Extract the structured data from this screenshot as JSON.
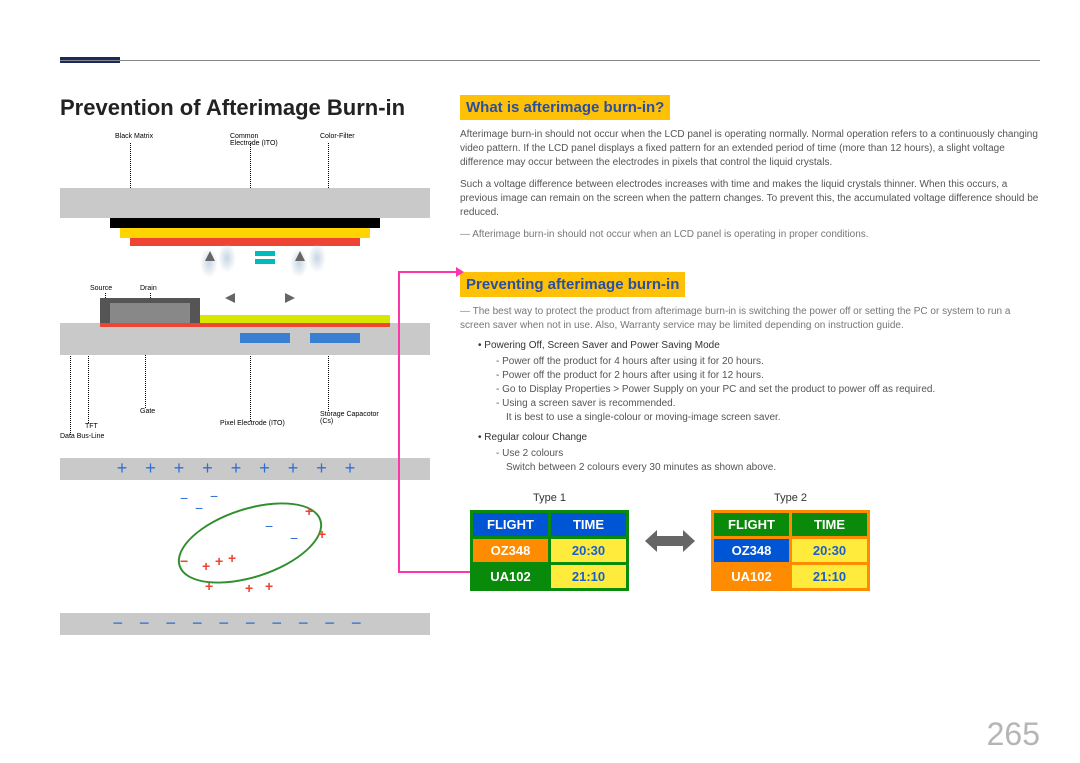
{
  "page_title": "Prevention of Afterimage Burn-in",
  "diagram_labels": {
    "black_matrix": "Black Matrix",
    "common_electrode": "Common Electrode (ITO)",
    "color_filter": "Color-Filter",
    "source": "Source",
    "drain": "Drain",
    "gate": "Gate",
    "tft": "TFT",
    "data_bus": "Data Bus-Line",
    "pixel_electrode": "Pixel Electrode (ITO)",
    "storage_cap": "Storage Capacotor (Cs)"
  },
  "section1": {
    "heading": "What is afterimage burn-in?",
    "p1": "Afterimage burn-in should not occur when the LCD panel is operating normally. Normal operation refers to a continuously changing video pattern. If the LCD panel displays a fixed pattern for an extended period of time (more than 12 hours), a slight voltage difference may occur between the electrodes in pixels that control the liquid crystals.",
    "p2": "Such a voltage difference between electrodes increases with time and makes the liquid crystals thinner. When this occurs, a previous image can remain on the screen when the pattern changes. To prevent this, the accumulated voltage difference should be reduced.",
    "note": "Afterimage burn-in should not occur when an LCD panel is operating in proper conditions."
  },
  "section2": {
    "heading": "Preventing afterimage burn-in",
    "note": "The best way to protect the product from afterimage burn-in is switching the power off or setting the PC or system to run a screen saver when not in use. Also, Warranty service may be limited depending on instruction guide.",
    "b1": "Powering Off, Screen Saver and Power Saving Mode",
    "b1_items": [
      "Power off the product for 4 hours after using it for 20 hours.",
      "Power off the product for 2 hours after using it for 12 hours.",
      "Go to Display Properties > Power Supply on your PC and set the product to power off as required.",
      "Using a screen saver is recommended."
    ],
    "b1_sub": "It is best to use a single-colour or moving-image screen saver.",
    "b2": "Regular colour Change",
    "b2_items": [
      "Use 2 colours"
    ],
    "b2_sub": "Switch between 2 colours every 30 minutes as shown above."
  },
  "types": {
    "type1_label": "Type 1",
    "type2_label": "Type 2",
    "headers": [
      "FLIGHT",
      "TIME"
    ],
    "rows": [
      [
        "OZ348",
        "20:30"
      ],
      [
        "UA102",
        "21:10"
      ]
    ]
  },
  "page_number": "265"
}
